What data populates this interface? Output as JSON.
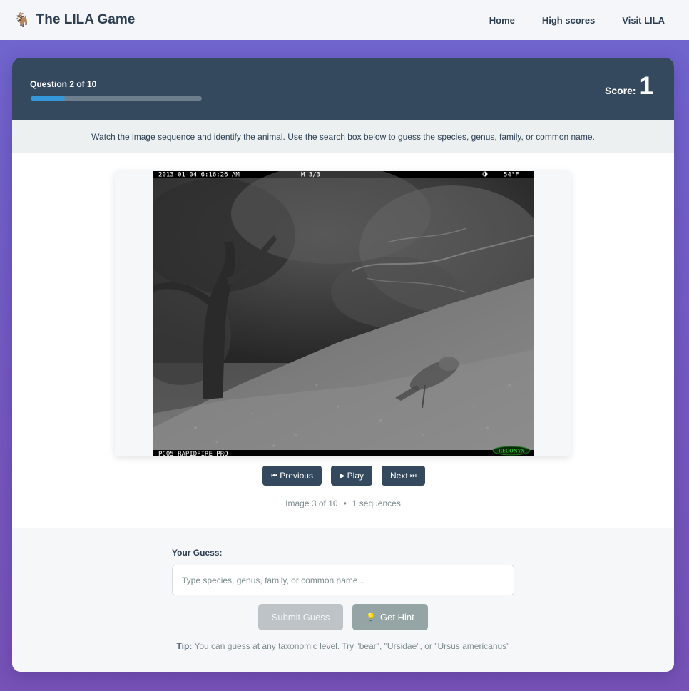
{
  "nav": {
    "brand_icon": "🐐",
    "brand_icon_name": "goat-icon",
    "brand": "The LILA Game",
    "links": [
      "Home",
      "High scores",
      "Visit LILA"
    ]
  },
  "game": {
    "question_text": "Question 2 of 10",
    "progress_fraction": 0.2,
    "score_label": "Score:",
    "score_value": "1",
    "instructions": "Watch the image sequence and identify the animal. Use the search box below to guess the species, genus, family, or common name."
  },
  "image": {
    "overlay_top_left": "2013-01-04 6:16:26 AM",
    "overlay_top_mid": "M 3/3",
    "overlay_top_right": "54°F",
    "overlay_bottom_left": "PC05 RAPIDFIRE PRO",
    "overlay_logo": "RECONYX",
    "moon_icon": "moon-phase-icon"
  },
  "controls": {
    "previous_glyph": "⏮",
    "previous": "Previous",
    "play_glyph": "▶",
    "play": "Play",
    "next": "Next",
    "next_glyph": "⏭"
  },
  "meta": {
    "image_count": "Image 3 of 10",
    "separator": "•",
    "sequences": "1 sequences"
  },
  "guess": {
    "label": "Your Guess:",
    "placeholder": "Type species, genus, family, or common name...",
    "submit": "Submit Guess",
    "hint_icon": "💡",
    "hint": "Get Hint",
    "tip_label": "Tip:",
    "tip_text": " You can guess at any taxonomic level. Try \"bear\", \"Ursidae\", or \"Ursus americanus\""
  },
  "colors": {
    "header": "#34495e",
    "progress": "#3498db",
    "button": "#34495e",
    "submit_disabled": "#bdc3c7",
    "hint": "#95a5a6"
  }
}
